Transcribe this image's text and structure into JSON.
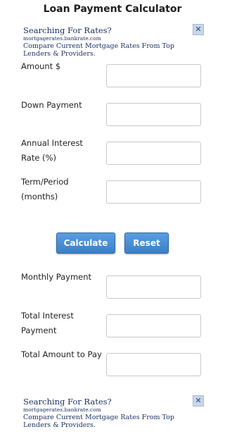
{
  "page": {
    "title": "Loan Payment Calculator"
  },
  "ad_top": {
    "headline": "Searching For Rates?",
    "url": "mortgagerates.bankrate.com",
    "description": "Compare Current Mortgage Rates From Top Lenders & Providers.",
    "close_icon": "close-icon"
  },
  "form": {
    "amount_label": "Amount $",
    "amount_value": "",
    "down_payment_label": "Down Payment",
    "down_payment_value": "",
    "rate_label_line1": "Annual Interest",
    "rate_label_line2": "Rate (%)",
    "rate_value": "",
    "term_label": "Term/Period (months)",
    "term_value": ""
  },
  "buttons": {
    "calculate": "Calculate",
    "reset": "Reset",
    "accent_color": "#4a8fd8"
  },
  "results": {
    "monthly_label": "Monthly Payment",
    "monthly_value": "",
    "total_interest_label": "Total Interest Payment",
    "total_interest_value": "",
    "total_amount_label": "Total Amount to Pay",
    "total_amount_value": ""
  },
  "ad_bottom": {
    "headline": "Searching For Rates?",
    "url": "mortgagerates.bankrate.com",
    "description": "Compare Current Mortgage Rates From Top Lenders & Providers.",
    "close_icon": "close-icon"
  }
}
